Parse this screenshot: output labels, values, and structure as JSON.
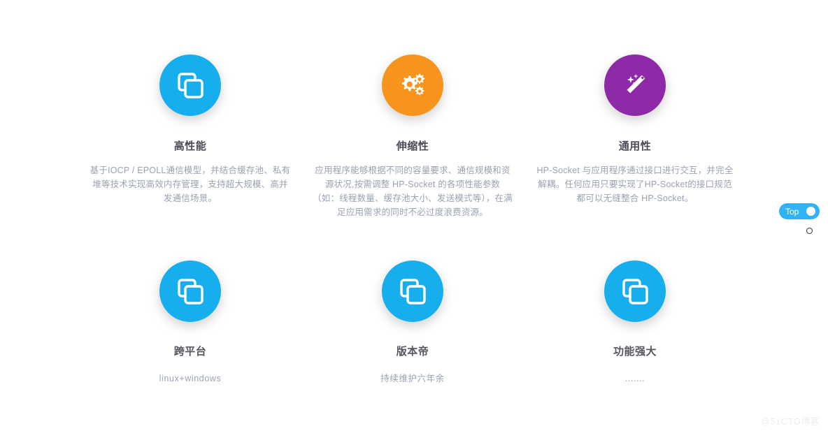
{
  "page": {
    "background_color": "#ffffff",
    "watermark": "@51CTO博客"
  },
  "features": {
    "top_row": [
      {
        "icon": "clone-icon",
        "icon_bg_color": "#17aeee",
        "title": "高性能",
        "description": "基于IOCP / EPOLL通信模型，并结合缓存池、私有堆等技术实现高效内存管理，支持超大规模、高并发通信场景。"
      },
      {
        "icon": "gears-icon",
        "icon_bg_color": "#f7941d",
        "title": "伸缩性",
        "description": "应用程序能够根据不同的容量要求、通信规模和资源状况,按需调整 HP-Socket 的各项性能参数（如：线程数量、缓存池大小、发送模式等），在满足应用需求的同时不必过度浪费资源。"
      },
      {
        "icon": "magic-wand-icon",
        "icon_bg_color": "#8e2aa8",
        "title": "通用性",
        "description": "HP-Socket 与应用程序通过接口进行交互，并完全解耦。任何应用只要实现了HP-Socket的接口规范都可以无缝整合 HP-Socket。"
      }
    ],
    "bottom_row": [
      {
        "icon": "clone-icon",
        "icon_bg_color": "#17aeee",
        "title": "跨平台",
        "description": "linux+windows"
      },
      {
        "icon": "clone-icon",
        "icon_bg_color": "#17aeee",
        "title": "版本帝",
        "description": "持续维护六年余"
      },
      {
        "icon": "clone-icon",
        "icon_bg_color": "#17aeee",
        "title": "功能强大",
        "description": "......."
      }
    ]
  },
  "back_to_top": {
    "label": "Top",
    "color": "#2fb3f6",
    "knob_color": "#ffffff"
  }
}
